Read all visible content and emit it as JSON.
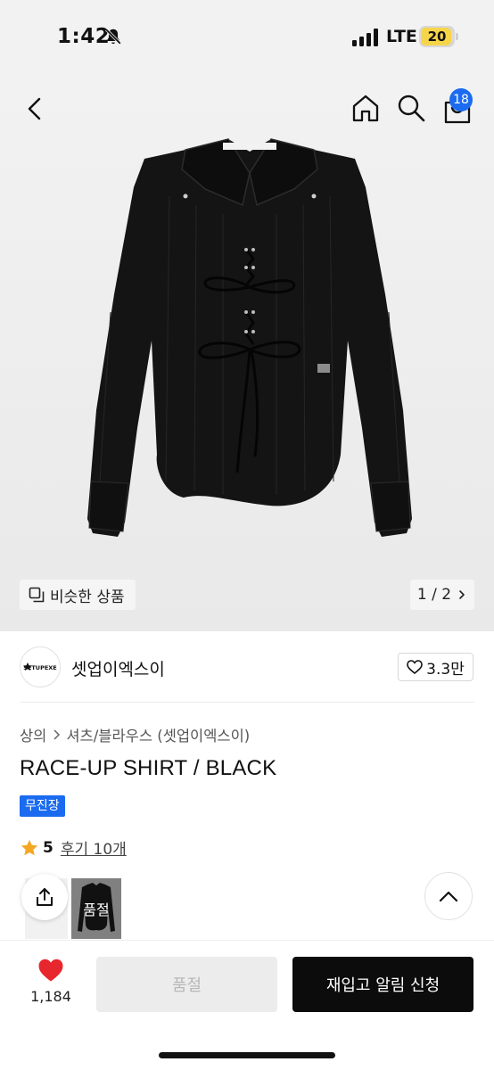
{
  "status_bar": {
    "time": "1:42",
    "network": "LTE",
    "battery": "20",
    "icons": [
      "bell-slash-icon",
      "signal-bars-icon",
      "battery-icon"
    ]
  },
  "header": {
    "cart_count": "18",
    "icons": [
      "chevron-left-icon",
      "home-icon",
      "search-icon",
      "cart-icon"
    ]
  },
  "gallery": {
    "similar_label": "비슷한 상품",
    "pager": "1 / 2"
  },
  "brand": {
    "logo_text": "SETUPEXE",
    "name": "셋업이엑스이",
    "likes": "3.3만"
  },
  "product": {
    "breadcrumb": [
      "상의",
      "셔츠/블라우스 (셋업이엑스이)"
    ],
    "title": "RACE-UP SHIRT / BLACK",
    "badge": "무진장",
    "rating": "5",
    "reviews": "후기 10개",
    "variant_soldout": "품절"
  },
  "bottom_bar": {
    "heart_count": "1,184",
    "soldout_label": "품절",
    "restock_label": "재입고 알림 신청"
  },
  "colors": {
    "accent_blue": "#1b6bf0",
    "heart_red": "#e8262d",
    "star_gold": "#f5a623",
    "cta_black": "#0c0c0c"
  }
}
